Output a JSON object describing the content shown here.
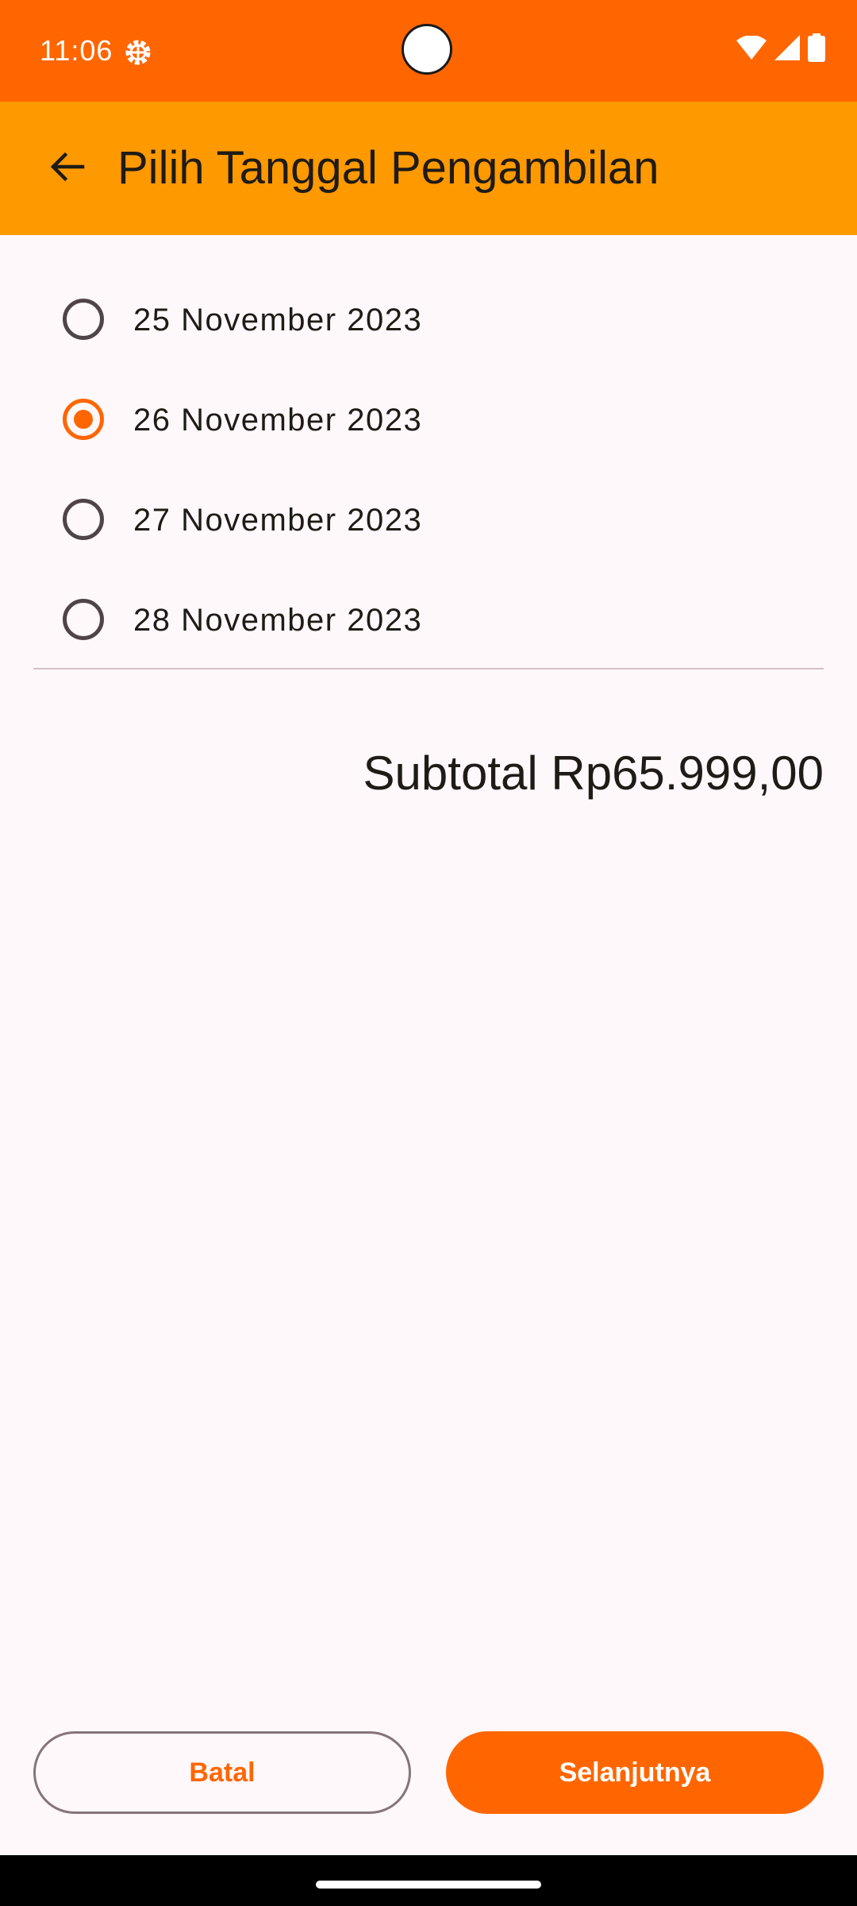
{
  "status_bar": {
    "time": "11:06",
    "icons": [
      "settings-icon",
      "wifi-icon",
      "signal-icon",
      "battery-icon"
    ],
    "background": "#FF6600"
  },
  "app_bar": {
    "title": "Pilih Tanggal Pengambilan",
    "back_icon": "arrow-back-icon",
    "background": "#FF9900"
  },
  "date_options": [
    {
      "label": "25 November 2023",
      "selected": false
    },
    {
      "label": "26 November 2023",
      "selected": true
    },
    {
      "label": "27 November 2023",
      "selected": false
    },
    {
      "label": "28 November 2023",
      "selected": false
    }
  ],
  "subtotal": {
    "text": "Subtotal Rp65.999,00"
  },
  "actions": {
    "cancel_label": "Batal",
    "next_label": "Selanjutnya"
  },
  "colors": {
    "accent": "#FF6600",
    "app_bar": "#FF9900",
    "background": "#FFF8FB"
  }
}
